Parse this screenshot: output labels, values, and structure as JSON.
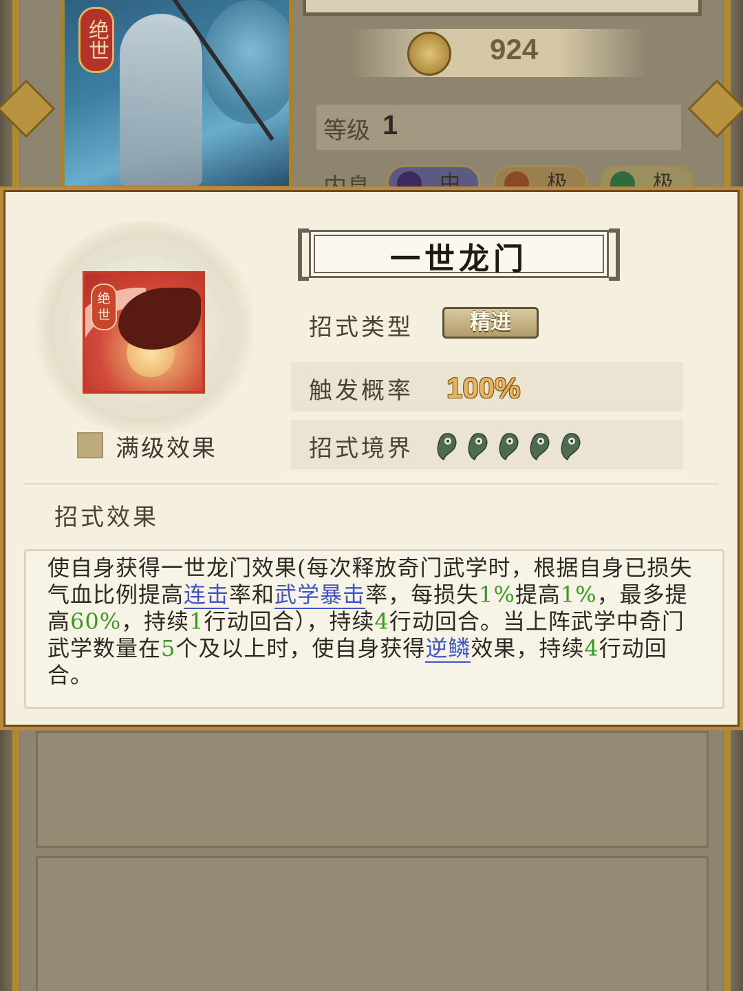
{
  "background": {
    "rank_badge": "绝世",
    "currency_value": "924",
    "level_label": "等级",
    "level_value": "1",
    "inner_label": "内息",
    "pills": [
      "中",
      "极",
      "极"
    ]
  },
  "dialog": {
    "skill_icon_tag": [
      "绝",
      "世"
    ],
    "max_level_label": "满级效果",
    "skill_name": "一世龙门",
    "attributes": {
      "type_label": "招式类型",
      "type_value": "精进",
      "trigger_label": "触发概率",
      "trigger_value": "100%",
      "realm_label": "招式境界",
      "realm_level": 5,
      "realm_max": 5
    },
    "effect_title": "招式效果",
    "effect_segments": [
      {
        "t": "使自身获得一世龙门效果(每次释放奇门武学时，根据自身已损失气血比例提高",
        "k": "text"
      },
      {
        "t": "连击",
        "k": "hl"
      },
      {
        "t": "率和",
        "k": "text"
      },
      {
        "t": "武学暴击",
        "k": "hl"
      },
      {
        "t": "率，每损失",
        "k": "text"
      },
      {
        "t": "1%",
        "k": "num"
      },
      {
        "t": "提高",
        "k": "text"
      },
      {
        "t": "1%",
        "k": "num"
      },
      {
        "t": "，最多提高",
        "k": "text"
      },
      {
        "t": "60%",
        "k": "num"
      },
      {
        "t": "，持续",
        "k": "text"
      },
      {
        "t": "1",
        "k": "num"
      },
      {
        "t": "行动回合），持续",
        "k": "text"
      },
      {
        "t": "4",
        "k": "num"
      },
      {
        "t": "行动回合。当上阵武学中奇门武学数量在",
        "k": "text"
      },
      {
        "t": "5",
        "k": "num"
      },
      {
        "t": "个及以上时，使自身获得",
        "k": "text"
      },
      {
        "t": "逆鳞",
        "k": "hl"
      },
      {
        "t": "效果，持续",
        "k": "text"
      },
      {
        "t": "4",
        "k": "num"
      },
      {
        "t": "行动回合。",
        "k": "text"
      }
    ]
  },
  "colors": {
    "dialog_bg": "#f4efdf",
    "dialog_border": "#b98a3c",
    "link_blue": "#3f55c5",
    "number_green": "#3a9a1f",
    "rate_gold": "#e8b45a",
    "jade": "#4e6b52"
  },
  "icons": {
    "currency": "gold-medal-icon",
    "realm_marker": "magatama-icon",
    "skill": "dragon-skill-icon"
  }
}
